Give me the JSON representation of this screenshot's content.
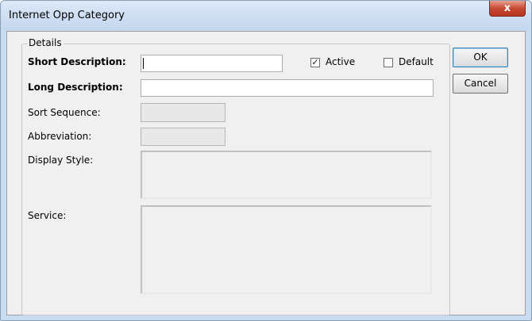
{
  "window": {
    "title": "Internet Opp Category",
    "close_glyph": "x"
  },
  "details": {
    "legend": "Details",
    "short_description": {
      "label": "Short Description:",
      "value": ""
    },
    "active": {
      "label": "Active",
      "checked": true,
      "mark": "✓"
    },
    "default": {
      "label": "Default",
      "checked": false
    },
    "long_description": {
      "label": "Long Description:",
      "value": ""
    },
    "sort_sequence": {
      "label": "Sort Sequence:"
    },
    "abbreviation": {
      "label": "Abbreviation:"
    },
    "display_style": {
      "label": "Display Style:"
    },
    "service": {
      "label": "Service:"
    }
  },
  "buttons": {
    "ok": "OK",
    "cancel": "Cancel"
  }
}
